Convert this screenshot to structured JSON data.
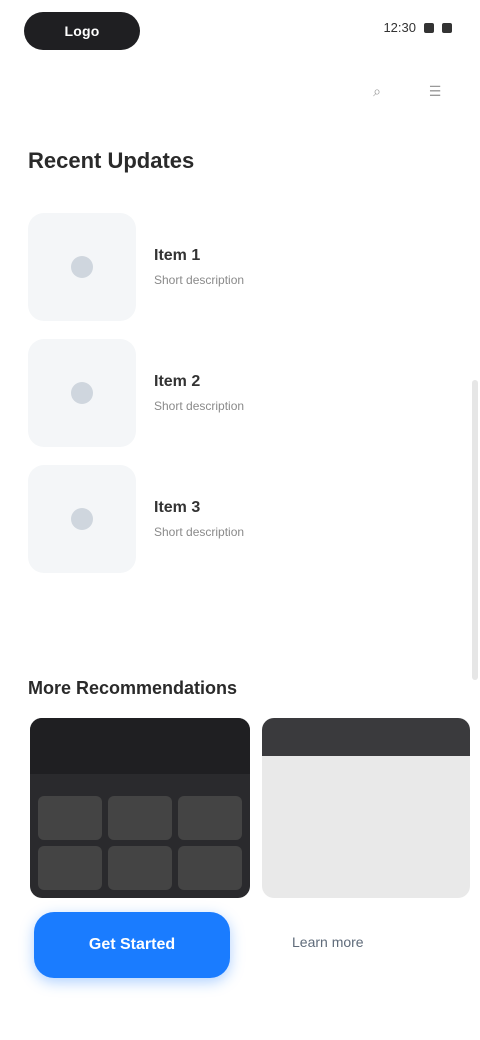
{
  "topbar": {
    "logo": "Logo",
    "status_time": "12:30",
    "icons": [
      "search-icon",
      "menu-icon"
    ]
  },
  "sections": {
    "recent_title": "Recent Updates",
    "more_title": "More Recommendations"
  },
  "list": [
    {
      "title": "Item 1",
      "subtitle": "Short description"
    },
    {
      "title": "Item 2",
      "subtitle": "Short description"
    },
    {
      "title": "Item 3",
      "subtitle": "Short description"
    }
  ],
  "actions": {
    "primary_label": "Get Started",
    "secondary_label": "Learn more"
  },
  "colors": {
    "primary": "#1a7cff",
    "dark": "#1f1f22"
  }
}
